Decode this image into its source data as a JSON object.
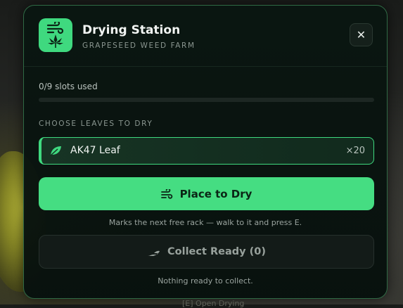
{
  "header": {
    "title": "Drying Station",
    "subtitle": "GRAPESEED WEED FARM",
    "close_label": "✕"
  },
  "slots": {
    "text": "0/9 slots used",
    "used": 0,
    "total": 9
  },
  "leaf_section": {
    "label": "CHOOSE LEAVES TO DRY",
    "selected": {
      "name": "AK47 Leaf",
      "count": "×20",
      "icon": "leaf-icon"
    }
  },
  "place_button": {
    "label": "Place to Dry",
    "icon": "wind-icon",
    "hint": "Marks the next free rack — walk to it and press E."
  },
  "collect_button": {
    "label": "Collect Ready (0)",
    "icon": "hand-icon",
    "status": "Nothing ready to collect."
  },
  "background": {
    "prompt": "[E] Open Drying"
  },
  "colors": {
    "accent": "#45dd82",
    "panel": "#0a1611",
    "border": "#2f6a45"
  }
}
